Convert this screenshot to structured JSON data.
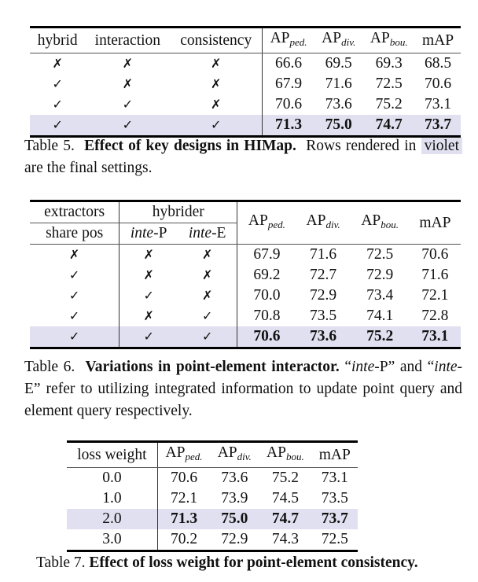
{
  "table5": {
    "headers": {
      "flags": [
        "hybrid",
        "interaction",
        "consistency"
      ],
      "metrics": [
        {
          "base": "AP",
          "sub": "ped."
        },
        {
          "base": "AP",
          "sub": "div."
        },
        {
          "base": "AP",
          "sub": "bou."
        },
        {
          "base": "mAP",
          "sub": ""
        }
      ]
    },
    "rows": [
      {
        "flags": [
          "✗",
          "✗",
          "✗"
        ],
        "values": [
          "66.6",
          "69.5",
          "69.3",
          "68.5"
        ],
        "highlight": false
      },
      {
        "flags": [
          "✓",
          "✗",
          "✗"
        ],
        "values": [
          "67.9",
          "71.6",
          "72.5",
          "70.6"
        ],
        "highlight": false
      },
      {
        "flags": [
          "✓",
          "✓",
          "✗"
        ],
        "values": [
          "70.6",
          "73.6",
          "75.2",
          "73.1"
        ],
        "highlight": false
      },
      {
        "flags": [
          "✓",
          "✓",
          "✓"
        ],
        "values": [
          "71.3",
          "75.0",
          "74.7",
          "73.7"
        ],
        "highlight": true
      }
    ],
    "caption": {
      "label": "Table 5.",
      "title": "Effect of key designs in HIMap.",
      "text_before": "Rows rendered in",
      "violet_word": "violet",
      "text_after": "are the final settings."
    }
  },
  "table6": {
    "group_headers": [
      "extractors",
      "hybrider"
    ],
    "sub_headers": [
      {
        "italic": "",
        "plain": "share pos"
      },
      {
        "italic": "inte",
        "plain": "-P"
      },
      {
        "italic": "inte",
        "plain": "-E"
      }
    ],
    "metrics": [
      {
        "base": "AP",
        "sub": "ped."
      },
      {
        "base": "AP",
        "sub": "div."
      },
      {
        "base": "AP",
        "sub": "bou."
      },
      {
        "base": "mAP",
        "sub": ""
      }
    ],
    "rows": [
      {
        "flags": [
          "✗",
          "✗",
          "✗"
        ],
        "values": [
          "67.9",
          "71.6",
          "72.5",
          "70.6"
        ],
        "highlight": false
      },
      {
        "flags": [
          "✓",
          "✗",
          "✗"
        ],
        "values": [
          "69.2",
          "72.7",
          "72.9",
          "71.6"
        ],
        "highlight": false
      },
      {
        "flags": [
          "✓",
          "✓",
          "✗"
        ],
        "values": [
          "70.0",
          "72.9",
          "73.4",
          "72.1"
        ],
        "highlight": false
      },
      {
        "flags": [
          "✓",
          "✗",
          "✓"
        ],
        "values": [
          "70.8",
          "73.5",
          "74.1",
          "72.8"
        ],
        "highlight": false
      },
      {
        "flags": [
          "✓",
          "✓",
          "✓"
        ],
        "values": [
          "70.6",
          "73.6",
          "75.2",
          "73.1"
        ],
        "highlight": true
      }
    ],
    "caption": {
      "label": "Table 6.",
      "title": "Variations in point-element interactor.",
      "q1_italic": "inte",
      "q1_plain": "-P",
      "and": "and",
      "q2_italic": "inte",
      "q2_plain": "-E",
      "rest": "refer to utilizing integrated information to update point query and element query respectively."
    }
  },
  "table7": {
    "first_header": "loss weight",
    "metrics": [
      {
        "base": "AP",
        "sub": "ped."
      },
      {
        "base": "AP",
        "sub": "div."
      },
      {
        "base": "AP",
        "sub": "bou."
      },
      {
        "base": "mAP",
        "sub": ""
      }
    ],
    "rows": [
      {
        "weight": "0.0",
        "values": [
          "70.6",
          "73.6",
          "75.2",
          "73.1"
        ],
        "highlight": false
      },
      {
        "weight": "1.0",
        "values": [
          "72.1",
          "73.9",
          "74.5",
          "73.5"
        ],
        "highlight": false
      },
      {
        "weight": "2.0",
        "values": [
          "71.3",
          "75.0",
          "74.7",
          "73.7"
        ],
        "highlight": true
      },
      {
        "weight": "3.0",
        "values": [
          "70.2",
          "72.9",
          "74.3",
          "72.5"
        ],
        "highlight": false
      }
    ],
    "caption": {
      "label": "Table 7.",
      "title": "Effect of loss weight for point-element consistency."
    }
  },
  "colors": {
    "highlight_violet": "#e1e0f0"
  }
}
